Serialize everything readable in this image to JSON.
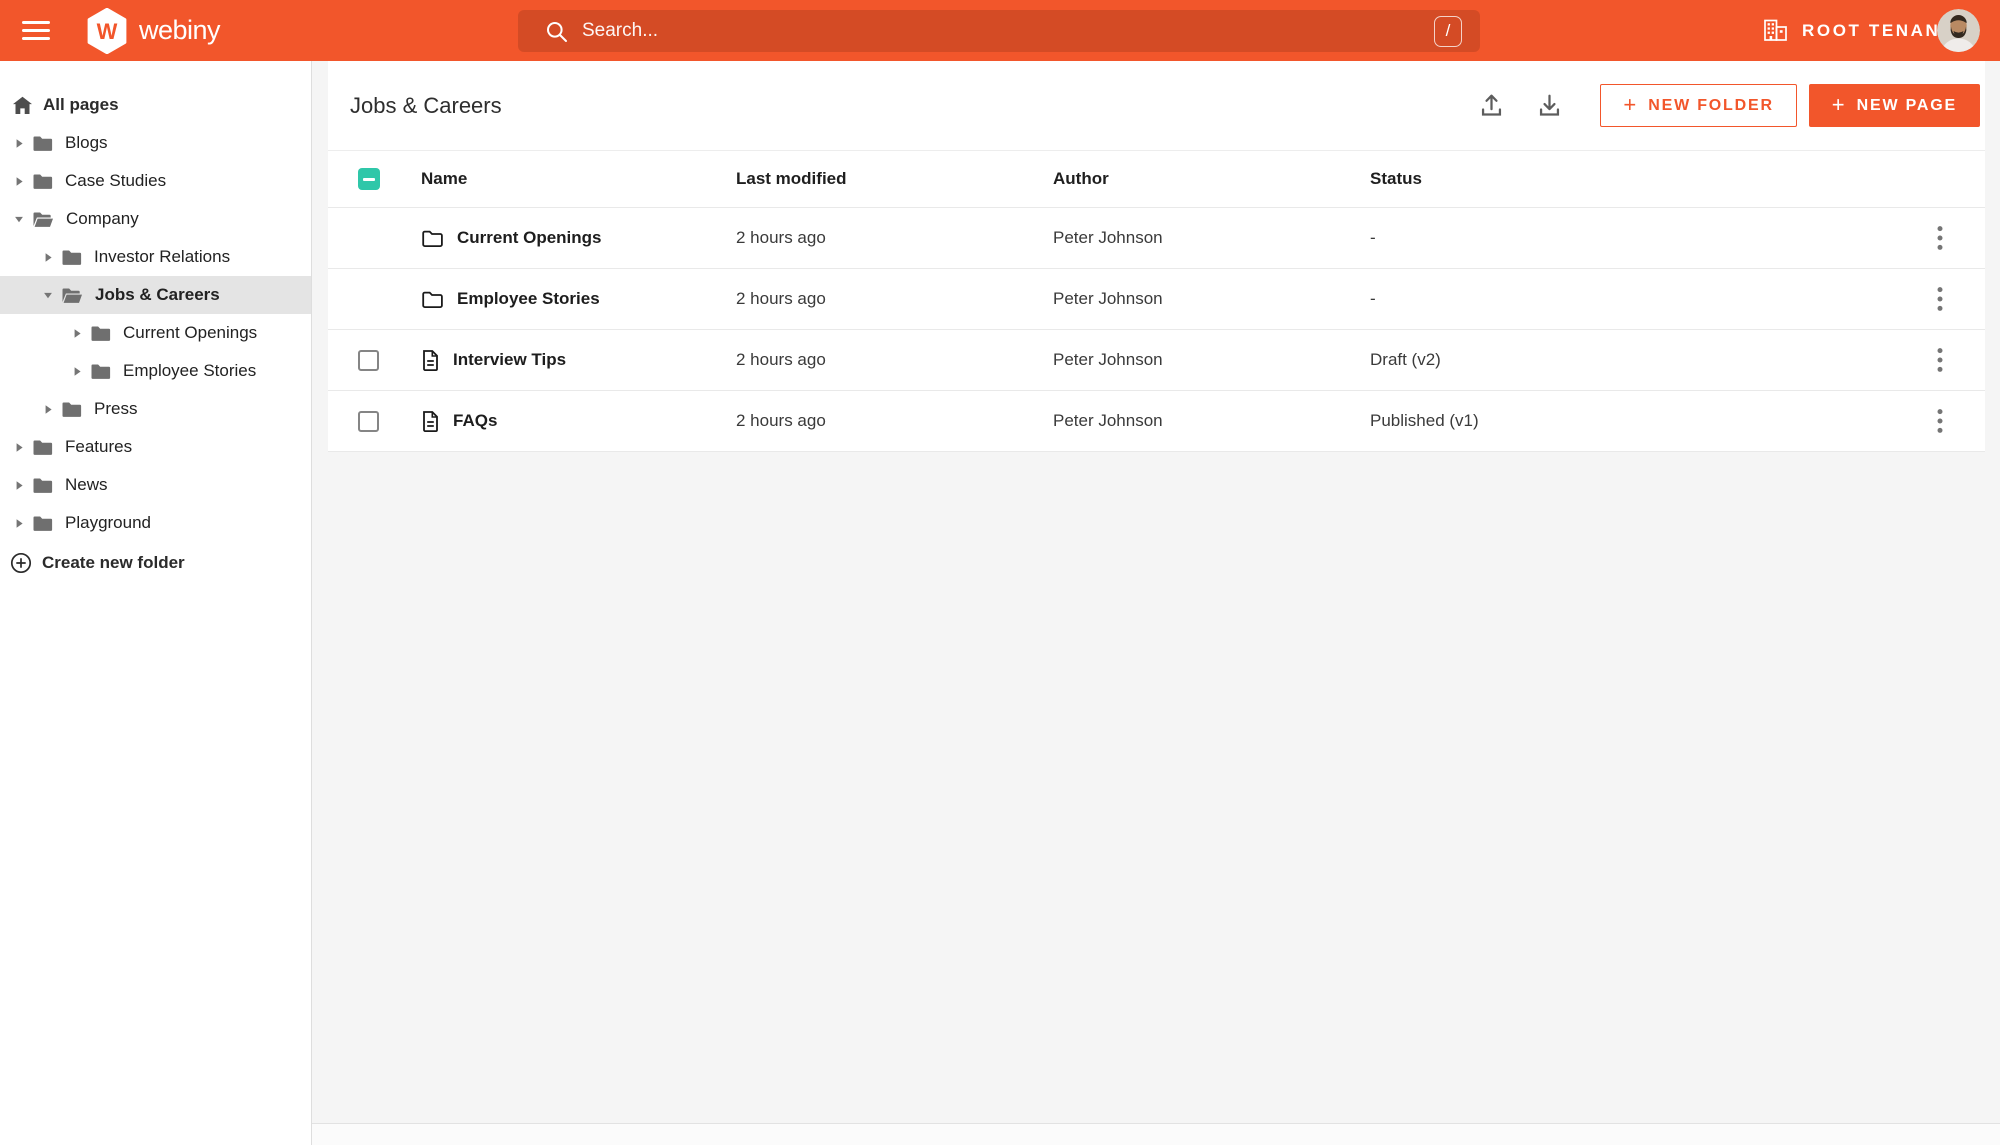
{
  "topbar": {
    "brand": "webiny",
    "search_placeholder": "Search...",
    "search_shortcut": "/",
    "tenant_label": "ROOT TENANT"
  },
  "sidebar": {
    "root_label": "All pages",
    "items": [
      {
        "label": "Blogs",
        "level": 0,
        "expanded": false,
        "selected": false
      },
      {
        "label": "Case Studies",
        "level": 0,
        "expanded": false,
        "selected": false
      },
      {
        "label": "Company",
        "level": 0,
        "expanded": true,
        "selected": false
      },
      {
        "label": "Investor Relations",
        "level": 1,
        "expanded": false,
        "selected": false
      },
      {
        "label": "Jobs & Careers",
        "level": 1,
        "expanded": true,
        "selected": true
      },
      {
        "label": "Current Openings",
        "level": 2,
        "expanded": false,
        "selected": false
      },
      {
        "label": "Employee Stories",
        "level": 2,
        "expanded": false,
        "selected": false
      },
      {
        "label": "Press",
        "level": 1,
        "expanded": false,
        "selected": false
      },
      {
        "label": "Features",
        "level": 0,
        "expanded": false,
        "selected": false
      },
      {
        "label": "News",
        "level": 0,
        "expanded": false,
        "selected": false
      },
      {
        "label": "Playground",
        "level": 0,
        "expanded": false,
        "selected": false
      }
    ],
    "create_folder_label": "Create new folder"
  },
  "main": {
    "title": "Jobs & Careers",
    "actions": {
      "new_folder_label": "NEW FOLDER",
      "new_page_label": "NEW PAGE",
      "plus_glyph": "+"
    },
    "table": {
      "columns": [
        "Name",
        "Last modified",
        "Author",
        "Status"
      ],
      "header_checkbox_state": "indeterminate",
      "rows": [
        {
          "type": "folder",
          "name": "Current Openings",
          "modified": "2 hours ago",
          "author": "Peter Johnson",
          "status": "-"
        },
        {
          "type": "folder",
          "name": "Employee Stories",
          "modified": "2 hours ago",
          "author": "Peter Johnson",
          "status": "-"
        },
        {
          "type": "page",
          "name": "Interview Tips",
          "modified": "2 hours ago",
          "author": "Peter Johnson",
          "status": "Draft (v2)"
        },
        {
          "type": "page",
          "name": "FAQs",
          "modified": "2 hours ago",
          "author": "Peter Johnson",
          "status": "Published (v1)"
        }
      ]
    }
  },
  "colors": {
    "brand_orange": "#f2562b",
    "checkbox_teal": "#2fc7a9",
    "sidebar_selected": "#e4e4e4"
  }
}
